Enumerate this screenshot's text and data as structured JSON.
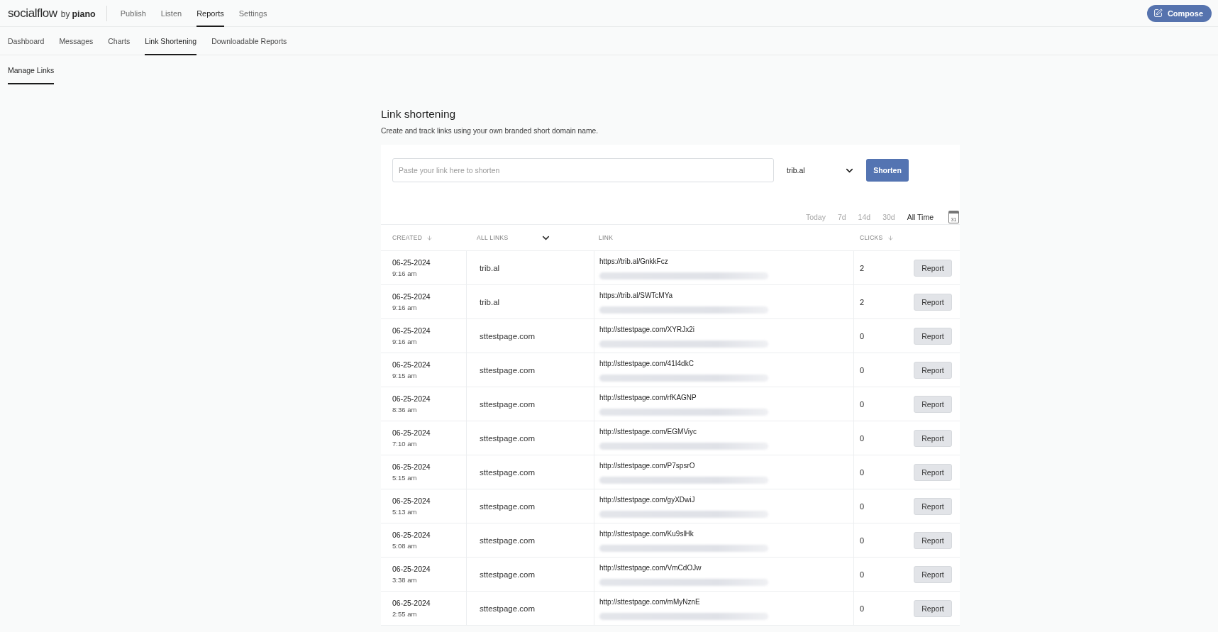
{
  "header": {
    "logo": {
      "wordmark": "socialflow",
      "byline": "by",
      "brand": "piano"
    },
    "nav": [
      {
        "label": "Publish",
        "selected": false
      },
      {
        "label": "Listen",
        "selected": false
      },
      {
        "label": "Reports",
        "selected": true
      },
      {
        "label": "Settings",
        "selected": false
      }
    ],
    "compose_button": "Compose"
  },
  "sub_nav": [
    {
      "label": "Dashboard",
      "selected": false
    },
    {
      "label": "Messages",
      "selected": false
    },
    {
      "label": "Charts",
      "selected": false
    },
    {
      "label": "Link Shortening",
      "selected": true
    },
    {
      "label": "Downloadable Reports",
      "selected": false
    }
  ],
  "section_tabs": [
    {
      "label": "Manage Links",
      "selected": true
    }
  ],
  "page": {
    "title": "Link shortening",
    "description": "Create and track links using your own branded short domain name."
  },
  "shorten_form": {
    "placeholder": "Paste your link here to shorten",
    "domain": "trib.al",
    "button": "Shorten"
  },
  "date_range": {
    "options": [
      {
        "label": "Today",
        "selected": false
      },
      {
        "label": "7d",
        "selected": false
      },
      {
        "label": "14d",
        "selected": false
      },
      {
        "label": "30d",
        "selected": false
      },
      {
        "label": "All Time",
        "selected": true
      }
    ],
    "calendar_day": "31"
  },
  "table": {
    "columns": [
      {
        "label": "CREATED",
        "kind": "sort"
      },
      {
        "label": "ALL LINKS",
        "kind": "dropdown"
      },
      {
        "label": "LINK",
        "kind": "plain"
      },
      {
        "label": "CLICKS",
        "kind": "sort"
      }
    ],
    "rows": [
      {
        "date": "06-25-2024",
        "time": "9:16 am",
        "domain": "trib.al",
        "link": "https://trib.al/GnkkFcz",
        "clicks": "2",
        "action": "Report"
      },
      {
        "date": "06-25-2024",
        "time": "9:16 am",
        "domain": "trib.al",
        "link": "https://trib.al/SWTcMYa",
        "clicks": "2",
        "action": "Report"
      },
      {
        "date": "06-25-2024",
        "time": "9:16 am",
        "domain": "sttestpage.com",
        "link": "http://sttestpage.com/XYRJx2i",
        "clicks": "0",
        "action": "Report"
      },
      {
        "date": "06-25-2024",
        "time": "9:15 am",
        "domain": "sttestpage.com",
        "link": "http://sttestpage.com/41I4dkC",
        "clicks": "0",
        "action": "Report"
      },
      {
        "date": "06-25-2024",
        "time": "8:36 am",
        "domain": "sttestpage.com",
        "link": "http://sttestpage.com/rfKAGNP",
        "clicks": "0",
        "action": "Report"
      },
      {
        "date": "06-25-2024",
        "time": "7:10 am",
        "domain": "sttestpage.com",
        "link": "http://sttestpage.com/EGMViyc",
        "clicks": "0",
        "action": "Report"
      },
      {
        "date": "06-25-2024",
        "time": "5:15 am",
        "domain": "sttestpage.com",
        "link": "http://sttestpage.com/P7spsrO",
        "clicks": "0",
        "action": "Report"
      },
      {
        "date": "06-25-2024",
        "time": "5:13 am",
        "domain": "sttestpage.com",
        "link": "http://sttestpage.com/gyXDwiJ",
        "clicks": "0",
        "action": "Report"
      },
      {
        "date": "06-25-2024",
        "time": "5:08 am",
        "domain": "sttestpage.com",
        "link": "http://sttestpage.com/Ku9slHk",
        "clicks": "0",
        "action": "Report"
      },
      {
        "date": "06-25-2024",
        "time": "3:38 am",
        "domain": "sttestpage.com",
        "link": "http://sttestpage.com/VmCdOJw",
        "clicks": "0",
        "action": "Report"
      },
      {
        "date": "06-25-2024",
        "time": "2:55 am",
        "domain": "sttestpage.com",
        "link": "http://sttestpage.com/mMyNznE",
        "clicks": "0",
        "action": "Report"
      }
    ]
  }
}
